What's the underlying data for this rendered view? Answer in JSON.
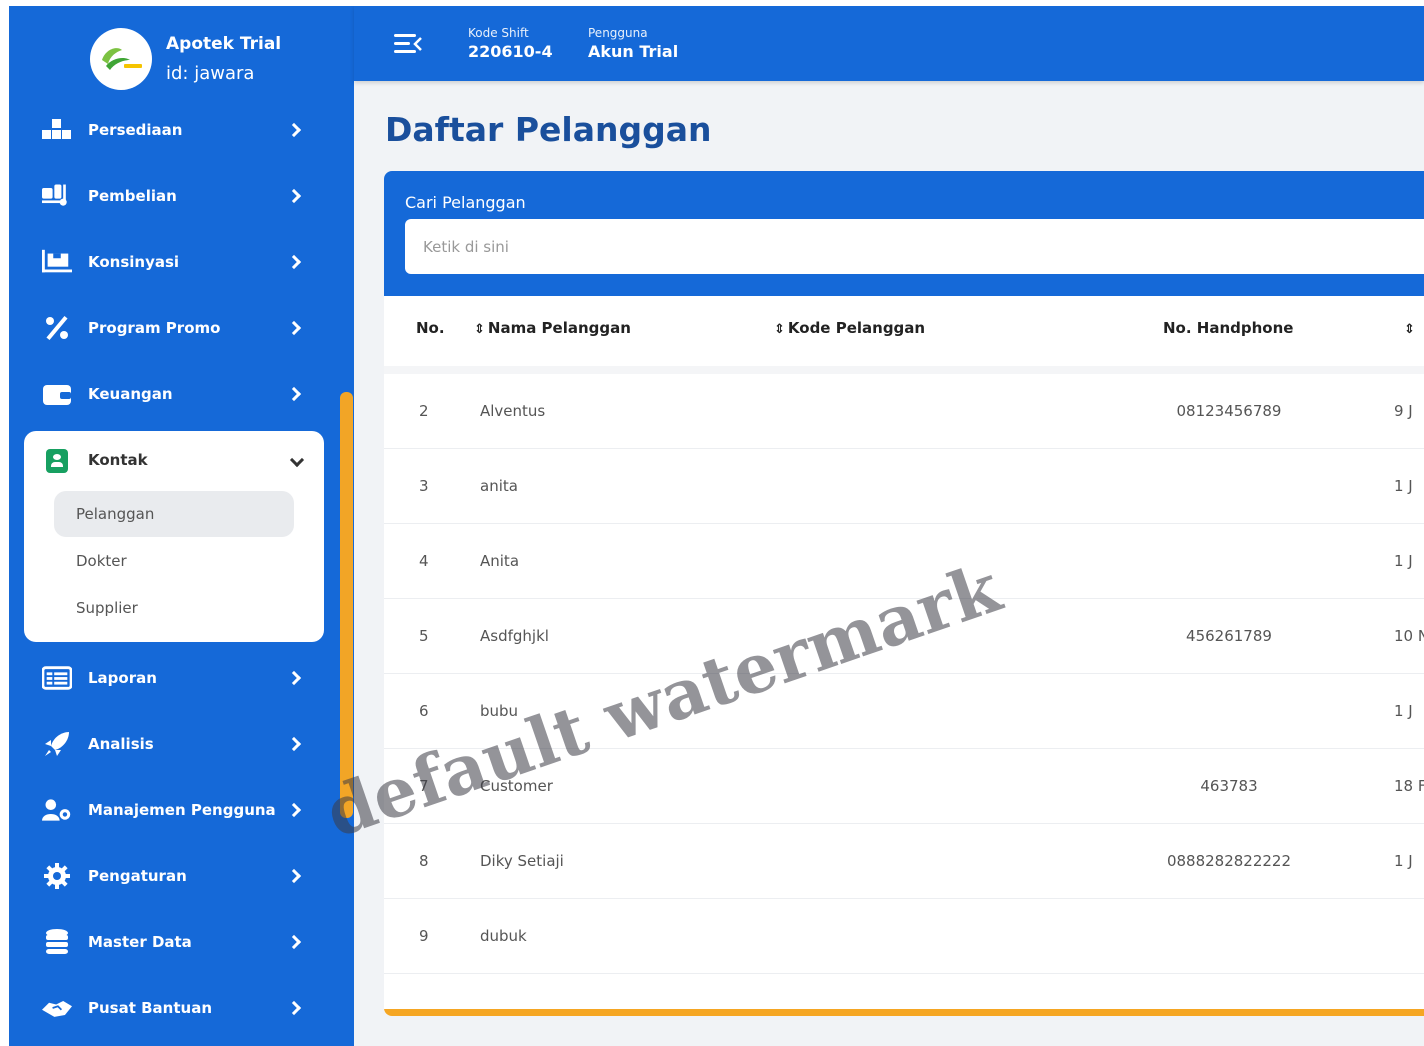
{
  "brand": {
    "name": "Apotek Trial",
    "id": "id: jawara"
  },
  "sidebar": {
    "items": [
      {
        "label": "Persediaan",
        "icon": "boxes-icon"
      },
      {
        "label": "Pembelian",
        "icon": "cart-icon"
      },
      {
        "label": "Konsinyasi",
        "icon": "pallet-icon"
      },
      {
        "label": "Program Promo",
        "icon": "percent-icon"
      },
      {
        "label": "Keuangan",
        "icon": "wallet-icon"
      },
      {
        "label": "Laporan",
        "icon": "report-icon"
      },
      {
        "label": "Analisis",
        "icon": "rocket-icon"
      },
      {
        "label": "Manajemen Pengguna",
        "icon": "user-gear-icon"
      },
      {
        "label": "Pengaturan",
        "icon": "gear-icon"
      },
      {
        "label": "Master Data",
        "icon": "database-icon"
      },
      {
        "label": "Pusat Bantuan",
        "icon": "handshake-icon"
      }
    ],
    "kontak": {
      "label": "Kontak",
      "sub": [
        {
          "label": "Pelanggan",
          "active": true
        },
        {
          "label": "Dokter",
          "active": false
        },
        {
          "label": "Supplier",
          "active": false
        }
      ]
    }
  },
  "header": {
    "shift_label": "Kode Shift",
    "shift_value": "220610-4",
    "user_label": "Pengguna",
    "user_value": "Akun Trial"
  },
  "page": {
    "title": "Daftar Pelanggan"
  },
  "search": {
    "label": "Cari Pelanggan",
    "placeholder": "Ketik di sini"
  },
  "table": {
    "headers": {
      "no": "No.",
      "nama": "Nama Pelanggan",
      "kode": "Kode Pelanggan",
      "hp": "No. Handphone"
    },
    "rows": [
      {
        "no": "2",
        "nama": "Alventus",
        "kode": "",
        "hp": "08123456789",
        "date": "9 J"
      },
      {
        "no": "3",
        "nama": "anita",
        "kode": "",
        "hp": "",
        "date": "1 J"
      },
      {
        "no": "4",
        "nama": "Anita",
        "kode": "",
        "hp": "",
        "date": "1 J"
      },
      {
        "no": "5",
        "nama": "Asdfghjkl",
        "kode": "",
        "hp": "456261789",
        "date": "10 N"
      },
      {
        "no": "6",
        "nama": "bubu",
        "kode": "",
        "hp": "",
        "date": "1 J"
      },
      {
        "no": "7",
        "nama": "Customer",
        "kode": "",
        "hp": "463783",
        "date": "18 F"
      },
      {
        "no": "8",
        "nama": "Diky Setiaji",
        "kode": "",
        "hp": "0888282822222",
        "date": "1 J"
      },
      {
        "no": "9",
        "nama": "dubuk",
        "kode": "",
        "hp": "",
        "date": ""
      }
    ]
  },
  "watermark": "default watermark",
  "colors": {
    "primary": "#1569d8",
    "accent": "#f5a623",
    "title": "#1a4f9c",
    "kontak_icon": "#17a061"
  }
}
